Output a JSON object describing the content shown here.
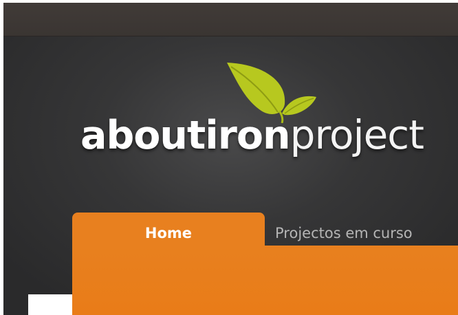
{
  "brand": {
    "name_bold": "aboutiron",
    "name_light": "project",
    "logo_icon": "leaf-icon",
    "leaf_color": "#b7c81f"
  },
  "nav": {
    "tabs": [
      {
        "label": "Home",
        "active": true
      },
      {
        "label": "Projectos em curso",
        "active": false
      }
    ]
  },
  "colors": {
    "accent": "#e8801f",
    "background": "#333334",
    "topbar": "#3d3835"
  }
}
